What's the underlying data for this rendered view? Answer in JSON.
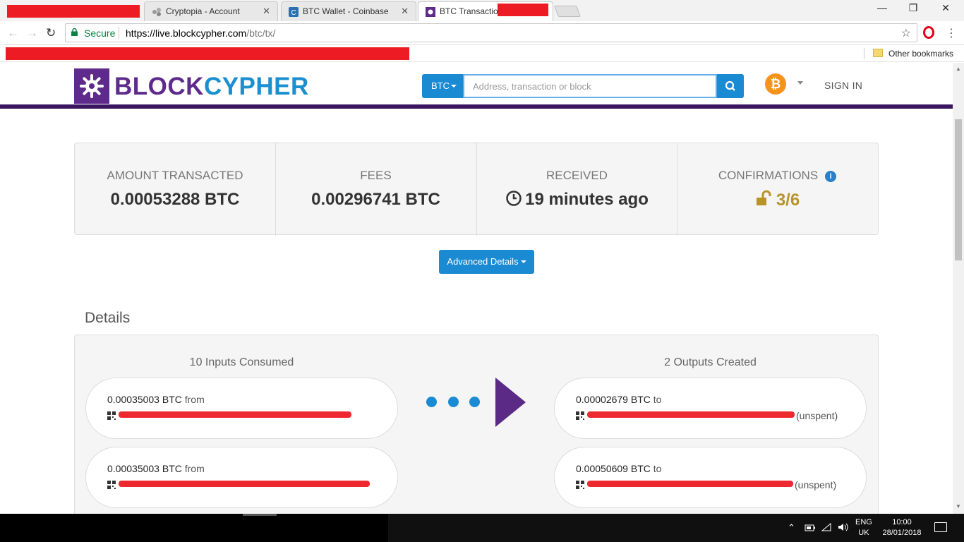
{
  "browser": {
    "tabs": [
      {
        "label": "",
        "redacted": true
      },
      {
        "label": "Cryptopia - Account"
      },
      {
        "label": "BTC Wallet - Coinbase"
      },
      {
        "label": "BTC Transaction",
        "active": true
      }
    ],
    "address_bar": {
      "secure_label": "Secure",
      "url_origin": "https://live.blockcypher.com",
      "url_path": "/btc/tx/"
    },
    "bookmarks": {
      "other_label": "Other bookmarks"
    }
  },
  "site": {
    "logo_part1": "BLOCK",
    "logo_part2": "CYPHER",
    "coin_select": "BTC",
    "search_placeholder": "Address, transaction or block",
    "coin_icon_glyph": "₿",
    "signin": "SIGN IN",
    "brand_purple": "#5e2b8c",
    "brand_blue": "#1a8ad3"
  },
  "summary": {
    "amount_label": "AMOUNT TRANSACTED",
    "amount_value": "0.00053288 BTC",
    "fees_label": "FEES",
    "fees_value": "0.00296741 BTC",
    "received_label": "RECEIVED",
    "received_value": "19 minutes ago",
    "confirmations_label": "CONFIRMATIONS",
    "confirmations_value": "3/6"
  },
  "advanced_details_label": "Advanced Details",
  "details": {
    "title": "Details",
    "inputs_heading": "10 Inputs Consumed",
    "outputs_heading": "2 Outputs Created",
    "inputs": [
      {
        "amount": "0.00035003 BTC",
        "word": "from"
      },
      {
        "amount": "0.00035003 BTC",
        "word": "from"
      }
    ],
    "outputs": [
      {
        "amount": "0.00002679 BTC",
        "word": "to",
        "status": "(unspent)"
      },
      {
        "amount": "0.00050609 BTC",
        "word": "to",
        "status": "(unspent)"
      }
    ]
  },
  "taskbar": {
    "lang_line1": "ENG",
    "lang_line2": "UK",
    "time": "10:00",
    "date": "28/01/2018"
  }
}
